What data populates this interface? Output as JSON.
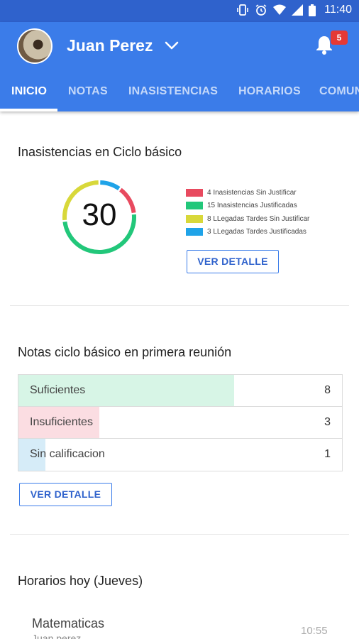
{
  "status_bar": {
    "time": "11:40",
    "icons": [
      "vibrate-icon",
      "alarm-icon",
      "wifi-icon",
      "signal-icon",
      "battery-icon"
    ]
  },
  "header": {
    "user_name": "Juan Perez",
    "notifications_count": "5"
  },
  "tabs": [
    {
      "label": "INICIO",
      "active": true
    },
    {
      "label": "NOTAS",
      "active": false
    },
    {
      "label": "INASISTENCIAS",
      "active": false
    },
    {
      "label": "HORARIOS",
      "active": false
    },
    {
      "label": "COMUN",
      "active": false
    }
  ],
  "absences": {
    "title": "Inasistencias en Ciclo básico",
    "total": "30",
    "legend": [
      {
        "label": "4 Inasistencias Sin Justificar",
        "color": "#e84a5f",
        "value": 4
      },
      {
        "label": "15 Inasistencias Justificadas",
        "color": "#22c77a",
        "value": 15
      },
      {
        "label": "8 LLegadas Tardes Sin Justificar",
        "color": "#d8d83a",
        "value": 8
      },
      {
        "label": "3 LLegadas Tardes Justificadas",
        "color": "#1fa3e8",
        "value": 3
      }
    ],
    "detail_button": "VER DETALLE"
  },
  "grades": {
    "title": "Notas ciclo básico en primera reunión",
    "rows": [
      {
        "label": "Suficientes",
        "count": "8",
        "fraction": 0.667,
        "color": "#d7f5e6"
      },
      {
        "label": "Insuficientes",
        "count": "3",
        "fraction": 0.25,
        "color": "#fbdde2"
      },
      {
        "label": "Sin calificacion",
        "count": "1",
        "fraction": 0.083,
        "color": "#d6ecf8"
      }
    ],
    "detail_button": "VER DETALLE"
  },
  "schedule": {
    "title": "Horarios hoy (Jueves)",
    "items": [
      {
        "subject": "Matematicas",
        "teacher": "Juan perez",
        "time": "10:55"
      }
    ]
  }
}
